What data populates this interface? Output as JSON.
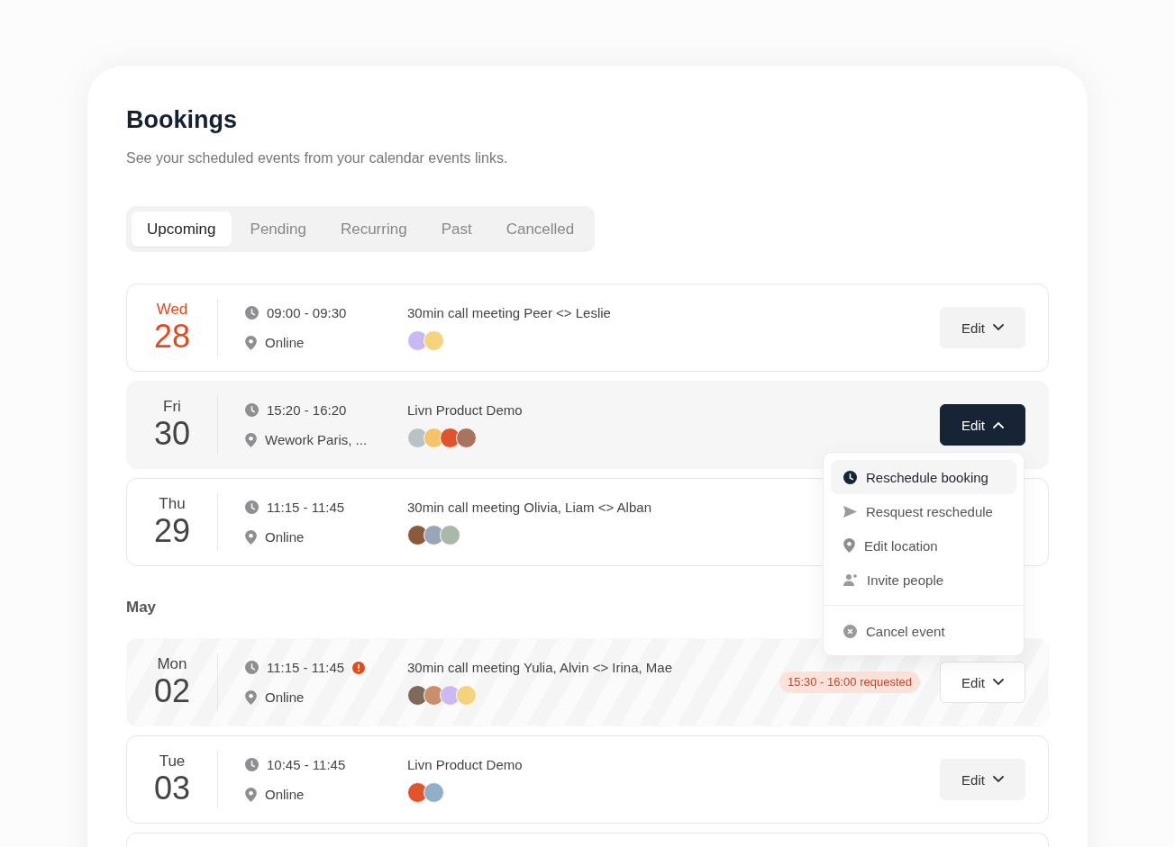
{
  "header": {
    "title": "Bookings",
    "subtitle": "See your scheduled events from your calendar events links."
  },
  "tabs": [
    {
      "label": "Upcoming",
      "selected": true
    },
    {
      "label": "Pending",
      "selected": false
    },
    {
      "label": "Recurring",
      "selected": false
    },
    {
      "label": "Past",
      "selected": false
    },
    {
      "label": "Cancelled",
      "selected": false
    }
  ],
  "sections": [
    {
      "bookings": [
        {
          "kind": "normal",
          "today": true,
          "day": "Wed",
          "date": "28",
          "time": "09:00 - 09:30",
          "alert": false,
          "location": "Online",
          "title": "30min call meeting Peer <> Leslie",
          "avatars": [
            {
              "color": "#c9b8f6"
            },
            {
              "color": "#f6d47e"
            }
          ],
          "edit": {
            "label": "Edit",
            "open": false
          }
        },
        {
          "kind": "active",
          "today": false,
          "day": "Fri",
          "date": "30",
          "time": "15:20 - 16:20",
          "alert": false,
          "location": "Wework Paris, ...",
          "title": "Livn Product Demo",
          "avatars": [
            {
              "color": "#b9c2c4"
            },
            {
              "color": "#f3c46a"
            },
            {
              "color": "#e2522b"
            },
            {
              "color": "#a9745f"
            }
          ],
          "edit": {
            "label": "Edit",
            "open": true
          },
          "menu": [
            {
              "kind": "clock",
              "label": "Reschedule booking",
              "selected": true
            },
            {
              "kind": "send",
              "label": "Resquest reschedule",
              "selected": false
            },
            {
              "kind": "pin",
              "label": "Edit location",
              "selected": false
            },
            {
              "kind": "invite",
              "label": "Invite people",
              "selected": false
            },
            {
              "kind": "cancel",
              "label": "Cancel event",
              "selected": false
            }
          ]
        },
        {
          "kind": "normal",
          "today": false,
          "day": "Thu",
          "date": "29",
          "time": "11:15 - 11:45",
          "alert": false,
          "location": "Online",
          "title": "30min call meeting Olivia, Liam <> Alban",
          "avatars": [
            {
              "color": "#8a5a3a"
            },
            {
              "color": "#9aa6b8"
            },
            {
              "color": "#a9b8a8"
            }
          ]
        }
      ]
    },
    {
      "label": "May",
      "bookings": [
        {
          "kind": "requested",
          "today": false,
          "day": "Mon",
          "date": "02",
          "time": "11:15 - 11:45",
          "alert": true,
          "location": "Online",
          "title": "30min call meeting Yulia, Alvin <> Irina, Mae",
          "avatars": [
            {
              "color": "#7d6a5a"
            },
            {
              "color": "#c98f6a"
            },
            {
              "color": "#cbbaf2"
            },
            {
              "color": "#f5d37c"
            }
          ],
          "request": "15:30 - 16:00 requested",
          "edit": {
            "label": "Edit",
            "open": false
          }
        },
        {
          "kind": "normal",
          "today": false,
          "day": "Tue",
          "date": "03",
          "time": "10:45 - 11:45",
          "alert": false,
          "location": "Online",
          "title": "Livn Product Demo",
          "avatars": [
            {
              "color": "#e2522b"
            },
            {
              "color": "#8fb0c8"
            }
          ],
          "edit": {
            "label": "Edit",
            "open": false
          }
        }
      ]
    }
  ]
}
